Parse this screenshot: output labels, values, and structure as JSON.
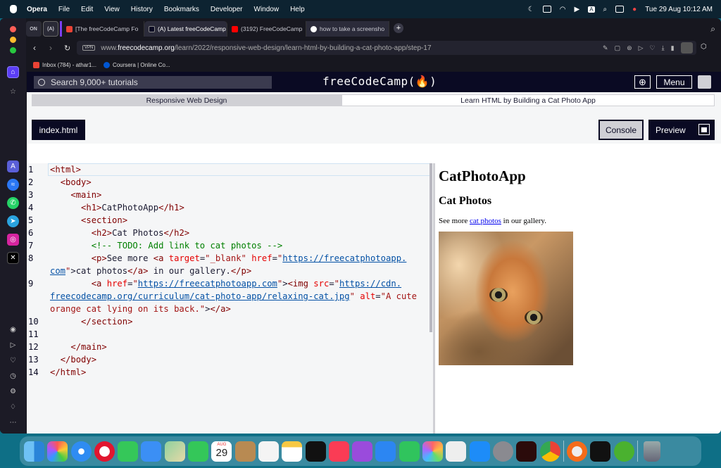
{
  "menubar": {
    "app": "Opera",
    "items": [
      "File",
      "Edit",
      "View",
      "History",
      "Bookmarks",
      "Developer",
      "Window",
      "Help"
    ],
    "datetime": "Tue 29 Aug  10:12 AM",
    "input_badge": "A"
  },
  "browser": {
    "tabs": [
      {
        "label": "[The freeCodeCamp Fo",
        "favicon": "gmail-icon",
        "color": "#ea4335"
      },
      {
        "label": "(A) Latest freeCodeCamp S",
        "favicon": "fcc-icon",
        "color": "#0a0a23"
      },
      {
        "label": "(3192) FreeCodeCamp",
        "favicon": "youtube-icon",
        "color": "#ff0000"
      },
      {
        "label": "how to take a screensho",
        "favicon": "google-icon",
        "color": "#4285f4"
      }
    ],
    "pinned": [
      "ON",
      "(A)"
    ],
    "url_prefix": "www.",
    "url_domain": "freecodecamp.org",
    "url_path": "/learn/2022/responsive-web-design/learn-html-by-building-a-cat-photo-app/step-17",
    "vpn_label": "VPN",
    "bookmarks": [
      {
        "label": "Inbox (784) - athar1...",
        "color": "#ea4335"
      },
      {
        "label": "Coursera | Online Co...",
        "color": "#0056d2"
      }
    ]
  },
  "fcc": {
    "search_placeholder": "Search 9,000+ tutorials",
    "logo": "freeCodeCamp(🔥)",
    "menu_label": "Menu",
    "breadcrumb_course": "Responsive Web Design",
    "breadcrumb_project": "Learn HTML by Building a Cat Photo App",
    "file_tab": "index.html",
    "console_label": "Console",
    "preview_label": "Preview"
  },
  "editor": {
    "line_numbers": [
      "1",
      "2",
      "3",
      "4",
      "5",
      "6",
      "7",
      "8",
      "",
      "9",
      "",
      "",
      "10",
      "11",
      "12",
      "13",
      "14"
    ]
  },
  "preview": {
    "h1": "CatPhotoApp",
    "h2": "Cat Photos",
    "p_before": "See more ",
    "p_link": "cat photos",
    "p_after": " in our gallery.",
    "img_alt": "A cute orange cat lying on its back."
  },
  "dock": {
    "calendar_month": "AUG",
    "calendar_day": "29"
  }
}
